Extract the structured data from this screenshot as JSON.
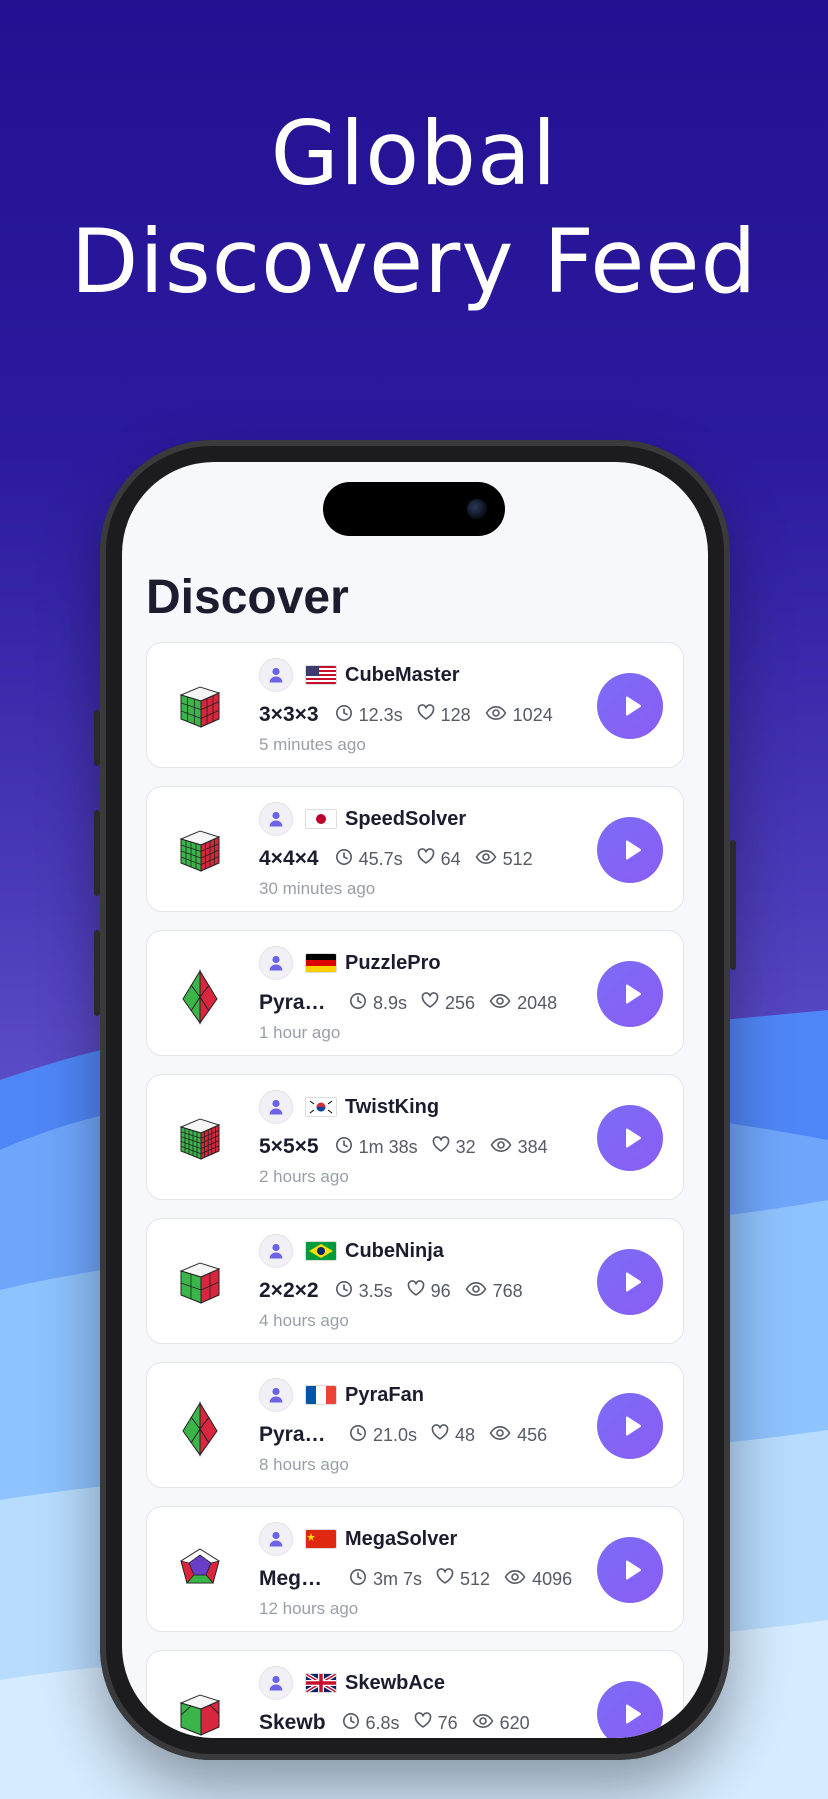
{
  "headline": {
    "line1": "Global",
    "line2": "Discovery Feed"
  },
  "screen": {
    "title": "Discover"
  },
  "feed": [
    {
      "username": "CubeMaster",
      "country": "us",
      "puzzle": "3×3×3",
      "puzzle_icon": "cube-3x3-icon",
      "time": "12.3s",
      "likes": "128",
      "views": "1024",
      "ago": "5 minutes ago"
    },
    {
      "username": "SpeedSolver",
      "country": "jp",
      "puzzle": "4×4×4",
      "puzzle_icon": "cube-4x4-icon",
      "time": "45.7s",
      "likes": "64",
      "views": "512",
      "ago": "30 minutes ago"
    },
    {
      "username": "PuzzlePro",
      "country": "de",
      "puzzle": "Pyraminx",
      "puzzle_icon": "pyraminx-icon",
      "time": "8.9s",
      "likes": "256",
      "views": "2048",
      "ago": "1 hour ago"
    },
    {
      "username": "TwistKing",
      "country": "kr",
      "puzzle": "5×5×5",
      "puzzle_icon": "cube-5x5-icon",
      "time": "1m 38s",
      "likes": "32",
      "views": "384",
      "ago": "2 hours ago"
    },
    {
      "username": "CubeNinja",
      "country": "br",
      "puzzle": "2×2×2",
      "puzzle_icon": "cube-2x2-icon",
      "time": "3.5s",
      "likes": "96",
      "views": "768",
      "ago": "4 hours ago"
    },
    {
      "username": "PyraFan",
      "country": "fr",
      "puzzle": "Pyraminx",
      "puzzle_icon": "pyraminx-icon",
      "time": "21.0s",
      "likes": "48",
      "views": "456",
      "ago": "8 hours ago"
    },
    {
      "username": "MegaSolver",
      "country": "cn",
      "puzzle": "Megaminx",
      "puzzle_icon": "megaminx-icon",
      "time": "3m 7s",
      "likes": "512",
      "views": "4096",
      "ago": "12 hours ago"
    },
    {
      "username": "SkewbAce",
      "country": "gb",
      "puzzle": "Skewb",
      "puzzle_icon": "skewb-icon",
      "time": "6.8s",
      "likes": "76",
      "views": "620",
      "ago": ""
    }
  ],
  "colors": {
    "accent": "#7b6cf6",
    "headline_bg": "#221191"
  }
}
